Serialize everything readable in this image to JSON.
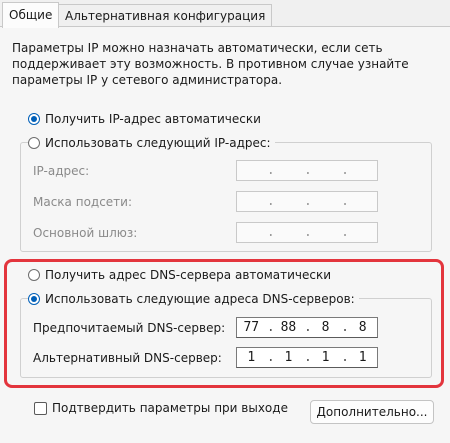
{
  "tabs": [
    {
      "label": "Общие"
    },
    {
      "label": "Альтернативная конфигурация"
    }
  ],
  "description": [
    "Параметры IP можно назначать автоматически, если сеть",
    "поддерживает эту возможность. В противном случае узнайте",
    "параметры IP у сетевого администратора."
  ],
  "ip_section": {
    "auto_label": "Получить IP-адрес автоматически",
    "manual_label": "Использовать следующий IP-адрес:",
    "ip_label": "IP-адрес:",
    "mask_label": "Маска подсети:",
    "gateway_label": "Основной шлюз:",
    "ip_value": [
      ".",
      ".",
      "."
    ],
    "selected": "auto"
  },
  "dns_section": {
    "auto_label": "Получить адрес DNS-сервера автоматически",
    "manual_label": "Использовать следующие адреса DNS-серверов:",
    "preferred_label": "Предпочитаемый DNS-сервер:",
    "alternate_label": "Альтернативный DNS-сервер:",
    "preferred": [
      "77",
      "88",
      "8",
      "8"
    ],
    "alternate": [
      "1",
      "1",
      "1",
      "1"
    ],
    "selected": "manual"
  },
  "footer": {
    "validate_label": "Подтвердить параметры при выходе",
    "advanced_label": "Дополнительно..."
  },
  "colors": {
    "highlight": "#e3353d",
    "accent": "#005fb8"
  }
}
